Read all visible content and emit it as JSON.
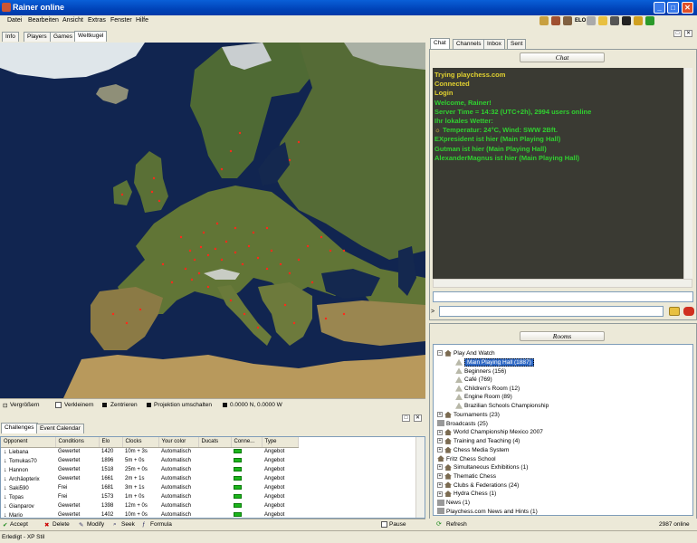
{
  "window": {
    "title": "Rainer online",
    "min": "_",
    "max": "□",
    "close": "✕"
  },
  "menu": [
    "Datei",
    "Bearbeiten",
    "Ansicht",
    "Extras",
    "Fenster",
    "Hilfe"
  ],
  "toolbar_icons": [
    {
      "name": "people-icon",
      "color": "#c8a040"
    },
    {
      "name": "phone-icon",
      "color": "#a05030"
    },
    {
      "name": "group-icon",
      "color": "#806040"
    },
    {
      "name": "elo-icon",
      "label": "ELO"
    },
    {
      "name": "calculator-icon",
      "color": "#aaa"
    },
    {
      "name": "chat-bubble-icon",
      "color": "#e8c040"
    },
    {
      "name": "pawn-icon",
      "color": "#555"
    },
    {
      "name": "yinyang-icon",
      "color": "#222"
    },
    {
      "name": "trophy-icon",
      "color": "#d0a020"
    },
    {
      "name": "green-square-icon",
      "color": "#2a9a2a"
    }
  ],
  "left_tabs": [
    "Info",
    "Players",
    "Games",
    "Weltkugel"
  ],
  "map_toolbar": {
    "zoom_in": "Vergrößern",
    "zoom_out": "Verkleinern",
    "center": "Zentrieren",
    "projection": "Projektion umschalten",
    "coords": "0.0000 N, 0.0000 W"
  },
  "challenge_tabs": [
    "Challenges",
    "Event Calendar"
  ],
  "challenges": {
    "columns": [
      "Opponent",
      "Conditions",
      "Elo",
      "Clocks",
      "Your color",
      "Ducats",
      "Conne...",
      "Type"
    ],
    "rows": [
      {
        "opponent": "Liebana",
        "conditions": "Gewertet",
        "elo": "1420",
        "clocks": "10m + 3s",
        "color": "Automatisch",
        "ducats": "",
        "type": "Angebot"
      },
      {
        "opponent": "Tomukas70",
        "conditions": "Gewertet",
        "elo": "1896",
        "clocks": "5m + 0s",
        "color": "Automatisch",
        "ducats": "",
        "type": "Angebot"
      },
      {
        "opponent": "Hannon",
        "conditions": "Gewertet",
        "elo": "1518",
        "clocks": "25m + 0s",
        "color": "Automatisch",
        "ducats": "",
        "type": "Angebot"
      },
      {
        "opponent": "Archäopterix",
        "conditions": "Gewertet",
        "elo": "1661",
        "clocks": "2m + 1s",
        "color": "Automatisch",
        "ducats": "",
        "type": "Angebot"
      },
      {
        "opponent": "Saki590",
        "conditions": "Frei",
        "elo": "1681",
        "clocks": "3m + 1s",
        "color": "Automatisch",
        "ducats": "",
        "type": "Angebot"
      },
      {
        "opponent": "Topas",
        "conditions": "Frei",
        "elo": "1573",
        "clocks": "1m + 0s",
        "color": "Automatisch",
        "ducats": "",
        "type": "Angebot"
      },
      {
        "opponent": "Gianparov",
        "conditions": "Gewertet",
        "elo": "1398",
        "clocks": "12m + 0s",
        "color": "Automatisch",
        "ducats": "",
        "type": "Angebot"
      },
      {
        "opponent": "Mario",
        "conditions": "Gewertet",
        "elo": "1402",
        "clocks": "10m + 0s",
        "color": "Automatisch",
        "ducats": "",
        "type": "Angebot"
      }
    ]
  },
  "actions": {
    "accept": "Accept",
    "delete": "Delete",
    "modify": "Modify",
    "seek": "Seek",
    "formula": "Formula",
    "pause": "Pause"
  },
  "status_left": "Erledigt - XP Stil",
  "status_right": "2987 online",
  "chat_tabs": [
    "Chat",
    "Channels",
    "Inbox",
    "Sent"
  ],
  "chat_header": "Chat",
  "chat_lines": [
    {
      "text": "Trying playchess.com",
      "color": "#e0d030"
    },
    {
      "text": "Connected",
      "color": "#e0d030"
    },
    {
      "text": "Login",
      "color": "#e0d030"
    },
    {
      "text": "Welcome, Rainer!",
      "color": "#30d030"
    },
    {
      "text": "Server Time = 14:32 (UTC+2h), 2994 users online",
      "color": "#30d030"
    },
    {
      "text": "Ihr lokales Wetter:",
      "color": "#30d030"
    },
    {
      "text": "Temperatur: 24°C, Wind: SWW 2Bft.",
      "color": "#30d030"
    },
    {
      "text": "EXpresident ist hier (Main Playing Hall)",
      "color": "#30d030"
    },
    {
      "text": "Gutman ist hier (Main Playing Hall)",
      "color": "#30d030"
    },
    {
      "text": "AlexanderMagnus ist hier (Main Playing Hall)",
      "color": "#30d030"
    }
  ],
  "chat_prompt": ">",
  "rooms_header": "Rooms",
  "rooms": {
    "play": "Play And Watch",
    "sub": [
      "Main Playing Hall  (1887)",
      "Beginners  (156)",
      "Café  (769)",
      "Children's Room  (12)",
      "Engine Room  (89)",
      "Brazilian Schools Championship"
    ],
    "top": [
      "Tournaments  (23)",
      "Broadcasts  (25)",
      "World Championship Mexico 2007",
      "Training and Teaching  (4)",
      "Chess Media System",
      "Fritz Chess School",
      "Simultaneous Exhibitions  (1)",
      "Thematic Chess",
      "Clubs & Federations  (24)",
      "Hydra Chess  (1)",
      "News  (1)",
      "Playchess.com News and Hints  (1)"
    ]
  },
  "refresh": "Refresh"
}
